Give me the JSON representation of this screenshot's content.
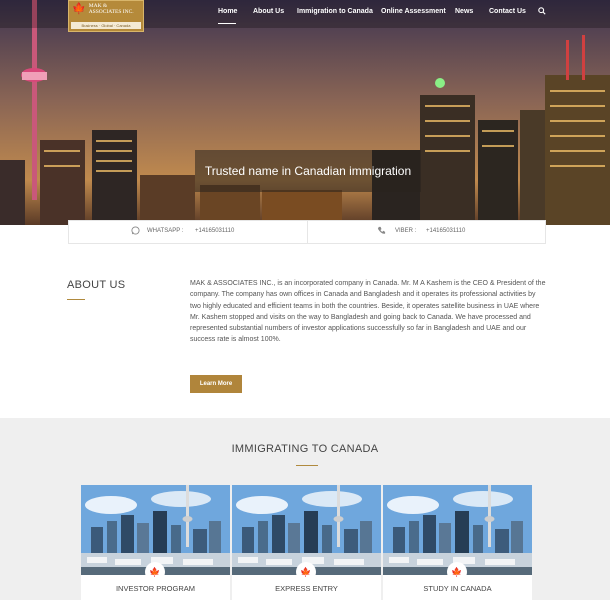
{
  "logo": {
    "name_line1": "MAK &",
    "name_line2": "ASSOCIATES INC.",
    "subline": "Business · Global · Canada"
  },
  "nav": {
    "items": [
      "Home",
      "About Us",
      "Immigration to Canada",
      "Online Assessment",
      "News",
      "Contact Us"
    ],
    "active": "Home"
  },
  "hero": {
    "headline": "Trusted name in Canadian immigration"
  },
  "contact": {
    "whatsapp_label": "WHATSAPP :",
    "whatsapp_number": "+14165031110",
    "viber_label": "VIBER :",
    "viber_number": "+14165031110"
  },
  "about": {
    "title": "ABOUT US",
    "body": "MAK & ASSOCIATES INC., is an incorporated company in Canada. Mr. M A Kashem is the CEO & President of the company. The company has own offices in Canada and Bangladesh and it operates its professional activities by two highly educated and efficient teams in both the countries. Beside, it operates satellite business in UAE where Mr. Kashem stopped and visits on the way to Bangladesh and going back to Canada. We have processed and represented substantial numbers of investor applications successfully so far in Bangladesh and UAE and our success rate is almost 100%.",
    "button": "Learn More"
  },
  "immigrating": {
    "title": "IMMIGRATING TO CANADA",
    "cards": [
      {
        "label": "INVESTOR PROGRAM"
      },
      {
        "label": "EXPRESS ENTRY"
      },
      {
        "label": "STUDY IN CANADA"
      }
    ]
  },
  "icons": {
    "search": "search-icon",
    "whatsapp": "whatsapp-icon",
    "viber": "phone-icon",
    "maple": "maple-leaf-icon"
  },
  "colors": {
    "accent": "#b0853b",
    "section_bg": "#efefef"
  }
}
